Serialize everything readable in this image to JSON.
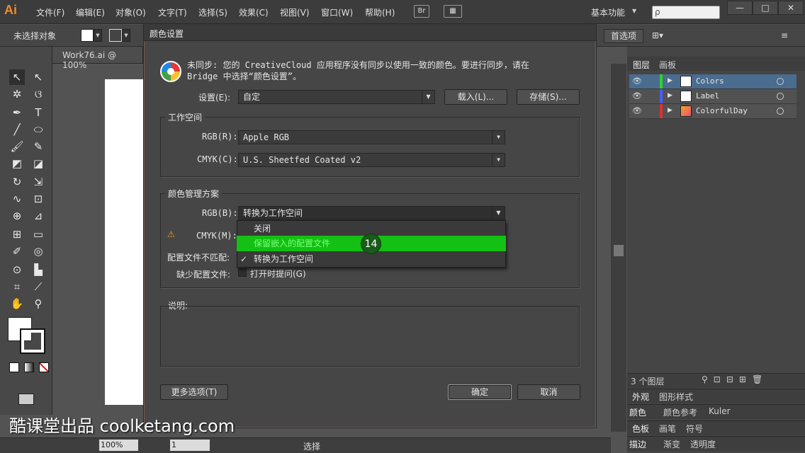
{
  "app": {
    "logo": "Ai",
    "workspace": "基本功能",
    "search_placeholder": "ρ"
  },
  "menus": [
    "文件(F)",
    "编辑(E)",
    "对象(O)",
    "文字(T)",
    "选择(S)",
    "效果(C)",
    "视图(V)",
    "窗口(W)",
    "帮助(H)"
  ],
  "bridge_btn": "Br",
  "window_controls": {
    "minimize": "—",
    "restore": "□",
    "close": "✕"
  },
  "control_bar": {
    "selection": "未选择对象",
    "preferences": "首选项"
  },
  "document": {
    "tab": "Work76.ai @ 100%"
  },
  "dialog": {
    "title": "颜色设置",
    "sync_message_line1": "未同步: 您的 CreativeCloud 应用程序没有同步以使用一致的颜色。要进行同步，请在",
    "sync_message_line2": "Bridge 中选择“颜色设置”。",
    "settings_label": "设置(E):",
    "settings_value": "自定",
    "load_button": "载入(L)...",
    "save_button": "存储(S)...",
    "workspace_group": "工作空间",
    "rgb_label": "RGB(R):",
    "rgb_value": "Apple RGB",
    "cmyk_label": "CMYK(C):",
    "cmyk_value": "U.S. Sheetfed Coated v2",
    "policies_group": "颜色管理方案",
    "rgb_policy_label": "RGB(B):",
    "rgb_policy_value": "转换为工作空间",
    "cmyk_policy_label": "CMYK(M):",
    "profile_mismatch_label": "配置文件不匹配:",
    "missing_profile_label": "缺少配置文件:",
    "missing_profile_checkbox": "打开时提问(G)",
    "description_label": "说明:",
    "more_options_button": "更多选项(T)",
    "ok_button": "确定",
    "cancel_button": "取消"
  },
  "dropdown": {
    "options": [
      {
        "label": "关闭",
        "checked": false,
        "highlighted": false
      },
      {
        "label": "保留嵌入的配置文件",
        "checked": false,
        "highlighted": true
      },
      {
        "label": "转换为工作空间",
        "checked": true,
        "highlighted": false
      }
    ],
    "step_badge": "14",
    "check_mark": "✓"
  },
  "layers_panel": {
    "tabs": [
      "图层",
      "画板"
    ],
    "layers": [
      {
        "name": "Colors",
        "color": "#2fd12f",
        "selected": true
      },
      {
        "name": "Label",
        "color": "#4a5aff",
        "selected": false
      },
      {
        "name": "ColorfulDay",
        "color": "#e03030",
        "selected": false
      }
    ],
    "count": "3 个图层"
  },
  "panels": {
    "appearance": [
      "外观",
      "图形样式"
    ],
    "color": [
      "颜色",
      "颜色参考",
      "Kuler"
    ],
    "swatches": [
      "色板",
      "画笔",
      "符号"
    ],
    "stroke": [
      "描边",
      "渐变",
      "透明度"
    ]
  },
  "status_bar": {
    "zoom": "100%",
    "page": "1",
    "mode": "选择"
  },
  "watermark": "酷课堂出品 coolketang.com",
  "colors": {
    "accent": "#f08a2b",
    "highlight": "#13c013",
    "selection": "#4a6c8e"
  }
}
